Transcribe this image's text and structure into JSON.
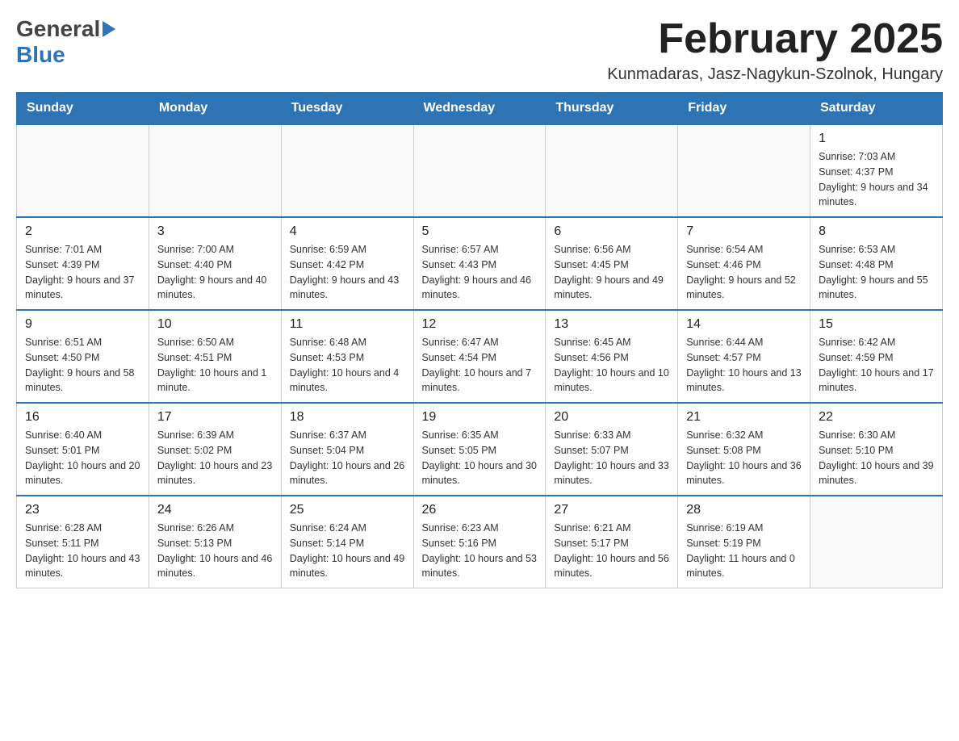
{
  "header": {
    "logo_general": "General",
    "logo_blue": "Blue",
    "month_title": "February 2025",
    "location": "Kunmadaras, Jasz-Nagykun-Szolnok, Hungary"
  },
  "weekdays": [
    "Sunday",
    "Monday",
    "Tuesday",
    "Wednesday",
    "Thursday",
    "Friday",
    "Saturday"
  ],
  "weeks": [
    [
      {
        "day": "",
        "info": ""
      },
      {
        "day": "",
        "info": ""
      },
      {
        "day": "",
        "info": ""
      },
      {
        "day": "",
        "info": ""
      },
      {
        "day": "",
        "info": ""
      },
      {
        "day": "",
        "info": ""
      },
      {
        "day": "1",
        "info": "Sunrise: 7:03 AM\nSunset: 4:37 PM\nDaylight: 9 hours and 34 minutes."
      }
    ],
    [
      {
        "day": "2",
        "info": "Sunrise: 7:01 AM\nSunset: 4:39 PM\nDaylight: 9 hours and 37 minutes."
      },
      {
        "day": "3",
        "info": "Sunrise: 7:00 AM\nSunset: 4:40 PM\nDaylight: 9 hours and 40 minutes."
      },
      {
        "day": "4",
        "info": "Sunrise: 6:59 AM\nSunset: 4:42 PM\nDaylight: 9 hours and 43 minutes."
      },
      {
        "day": "5",
        "info": "Sunrise: 6:57 AM\nSunset: 4:43 PM\nDaylight: 9 hours and 46 minutes."
      },
      {
        "day": "6",
        "info": "Sunrise: 6:56 AM\nSunset: 4:45 PM\nDaylight: 9 hours and 49 minutes."
      },
      {
        "day": "7",
        "info": "Sunrise: 6:54 AM\nSunset: 4:46 PM\nDaylight: 9 hours and 52 minutes."
      },
      {
        "day": "8",
        "info": "Sunrise: 6:53 AM\nSunset: 4:48 PM\nDaylight: 9 hours and 55 minutes."
      }
    ],
    [
      {
        "day": "9",
        "info": "Sunrise: 6:51 AM\nSunset: 4:50 PM\nDaylight: 9 hours and 58 minutes."
      },
      {
        "day": "10",
        "info": "Sunrise: 6:50 AM\nSunset: 4:51 PM\nDaylight: 10 hours and 1 minute."
      },
      {
        "day": "11",
        "info": "Sunrise: 6:48 AM\nSunset: 4:53 PM\nDaylight: 10 hours and 4 minutes."
      },
      {
        "day": "12",
        "info": "Sunrise: 6:47 AM\nSunset: 4:54 PM\nDaylight: 10 hours and 7 minutes."
      },
      {
        "day": "13",
        "info": "Sunrise: 6:45 AM\nSunset: 4:56 PM\nDaylight: 10 hours and 10 minutes."
      },
      {
        "day": "14",
        "info": "Sunrise: 6:44 AM\nSunset: 4:57 PM\nDaylight: 10 hours and 13 minutes."
      },
      {
        "day": "15",
        "info": "Sunrise: 6:42 AM\nSunset: 4:59 PM\nDaylight: 10 hours and 17 minutes."
      }
    ],
    [
      {
        "day": "16",
        "info": "Sunrise: 6:40 AM\nSunset: 5:01 PM\nDaylight: 10 hours and 20 minutes."
      },
      {
        "day": "17",
        "info": "Sunrise: 6:39 AM\nSunset: 5:02 PM\nDaylight: 10 hours and 23 minutes."
      },
      {
        "day": "18",
        "info": "Sunrise: 6:37 AM\nSunset: 5:04 PM\nDaylight: 10 hours and 26 minutes."
      },
      {
        "day": "19",
        "info": "Sunrise: 6:35 AM\nSunset: 5:05 PM\nDaylight: 10 hours and 30 minutes."
      },
      {
        "day": "20",
        "info": "Sunrise: 6:33 AM\nSunset: 5:07 PM\nDaylight: 10 hours and 33 minutes."
      },
      {
        "day": "21",
        "info": "Sunrise: 6:32 AM\nSunset: 5:08 PM\nDaylight: 10 hours and 36 minutes."
      },
      {
        "day": "22",
        "info": "Sunrise: 6:30 AM\nSunset: 5:10 PM\nDaylight: 10 hours and 39 minutes."
      }
    ],
    [
      {
        "day": "23",
        "info": "Sunrise: 6:28 AM\nSunset: 5:11 PM\nDaylight: 10 hours and 43 minutes."
      },
      {
        "day": "24",
        "info": "Sunrise: 6:26 AM\nSunset: 5:13 PM\nDaylight: 10 hours and 46 minutes."
      },
      {
        "day": "25",
        "info": "Sunrise: 6:24 AM\nSunset: 5:14 PM\nDaylight: 10 hours and 49 minutes."
      },
      {
        "day": "26",
        "info": "Sunrise: 6:23 AM\nSunset: 5:16 PM\nDaylight: 10 hours and 53 minutes."
      },
      {
        "day": "27",
        "info": "Sunrise: 6:21 AM\nSunset: 5:17 PM\nDaylight: 10 hours and 56 minutes."
      },
      {
        "day": "28",
        "info": "Sunrise: 6:19 AM\nSunset: 5:19 PM\nDaylight: 11 hours and 0 minutes."
      },
      {
        "day": "",
        "info": ""
      }
    ]
  ]
}
